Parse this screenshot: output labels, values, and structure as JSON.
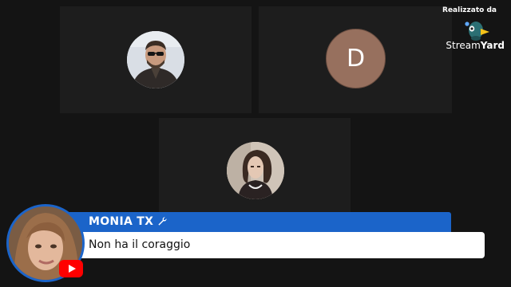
{
  "branding": {
    "made_with": "Realizzato da",
    "name_part1": "Stream",
    "name_part2": "Yard"
  },
  "participants": [
    {
      "kind": "photo",
      "icon": "man-sunglasses-photo"
    },
    {
      "kind": "initial",
      "initial": "D"
    },
    {
      "kind": "photo",
      "icon": "woman-photo"
    }
  ],
  "comment": {
    "author": "MONIA TX",
    "text": "Non ha il coraggio",
    "platform_icon": "youtube-icon",
    "badge_icon": "wrench-icon"
  },
  "colors": {
    "background": "#141414",
    "tile": "#1d1d1d",
    "name_bar": "#1b64c9",
    "avatar_initial_bg": "#97705e",
    "youtube_red": "#ff0000"
  }
}
